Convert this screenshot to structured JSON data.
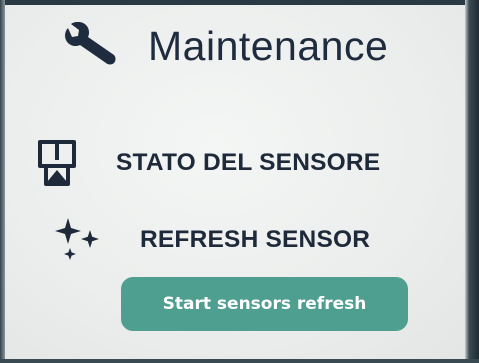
{
  "header": {
    "title": "Maintenance",
    "icon": "wrench-icon"
  },
  "rows": {
    "sensor_status": {
      "label": "STATO DEL SENSORE",
      "icon": "sensor-device-icon"
    },
    "refresh_sensor": {
      "label": "REFRESH SENSOR",
      "icon": "sparkles-icon"
    }
  },
  "actions": {
    "start_refresh_label": "Start sensors refresh"
  },
  "colors": {
    "text": "#1f2b3e",
    "button": "#4f9f91",
    "button_text": "#ffffff",
    "background": "#eceeed"
  }
}
